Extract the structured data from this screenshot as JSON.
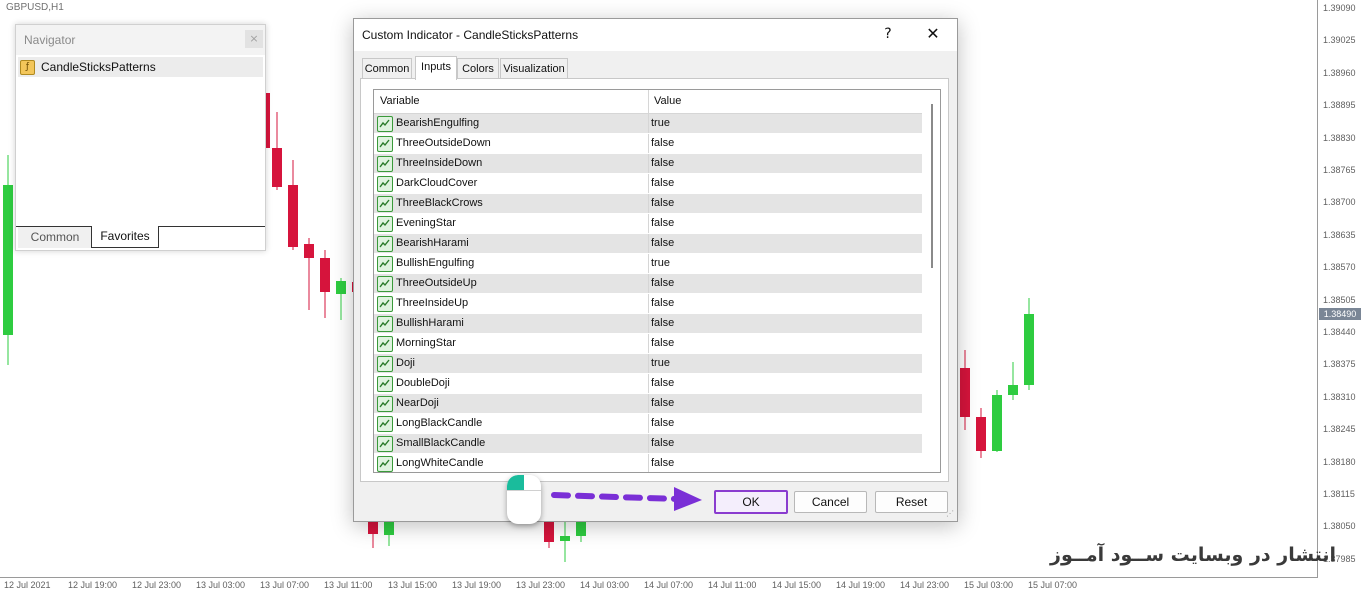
{
  "chart": {
    "symbol": "GBPUSD,H1",
    "current_price": "1.38490",
    "price_levels": [
      "1.39090",
      "1.39025",
      "1.38960",
      "1.38895",
      "1.38830",
      "1.38765",
      "1.38700",
      "1.38635",
      "1.38570",
      "1.38505",
      "1.38440",
      "1.38375",
      "1.38310",
      "1.38245",
      "1.38180",
      "1.38115",
      "1.38050",
      "1.37985"
    ],
    "time_labels": [
      "12 Jul 2021",
      "12 Jul 19:00",
      "12 Jul 23:00",
      "13 Jul 03:00",
      "13 Jul 07:00",
      "13 Jul 11:00",
      "13 Jul 15:00",
      "13 Jul 19:00",
      "13 Jul 23:00",
      "14 Jul 03:00",
      "14 Jul 07:00",
      "14 Jul 11:00",
      "14 Jul 15:00",
      "14 Jul 19:00",
      "14 Jul 23:00",
      "15 Jul 03:00",
      "15 Jul 07:00"
    ],
    "bull_color": "#2ecc40",
    "bear_color": "#d6143c"
  },
  "navigator": {
    "title": "Navigator",
    "close": "×",
    "item": "CandleSticksPatterns",
    "tabs": [
      "Common",
      "Favorites"
    ]
  },
  "dialog": {
    "title": "Custom Indicator - CandleSticksPatterns",
    "help": "?",
    "close": "✕",
    "tabs": [
      "Common",
      "Inputs",
      "Colors",
      "Visualization"
    ],
    "active_tab": "Inputs",
    "columns": {
      "variable": "Variable",
      "value": "Value"
    },
    "inputs": [
      {
        "variable": "BearishEngulfing",
        "value": "true"
      },
      {
        "variable": "ThreeOutsideDown",
        "value": "false"
      },
      {
        "variable": "ThreeInsideDown",
        "value": "false"
      },
      {
        "variable": "DarkCloudCover",
        "value": "false"
      },
      {
        "variable": "ThreeBlackCrows",
        "value": "false"
      },
      {
        "variable": "EveningStar",
        "value": "false"
      },
      {
        "variable": "BearishHarami",
        "value": "false"
      },
      {
        "variable": "BullishEngulfing",
        "value": "true"
      },
      {
        "variable": "ThreeOutsideUp",
        "value": "false"
      },
      {
        "variable": "ThreeInsideUp",
        "value": "false"
      },
      {
        "variable": "BullishHarami",
        "value": "false"
      },
      {
        "variable": "MorningStar",
        "value": "false"
      },
      {
        "variable": "Doji",
        "value": "true"
      },
      {
        "variable": "DoubleDoji",
        "value": "false"
      },
      {
        "variable": "NearDoji",
        "value": "false"
      },
      {
        "variable": "LongBlackCandle",
        "value": "false"
      },
      {
        "variable": "SmallBlackCandle",
        "value": "false"
      },
      {
        "variable": "LongWhiteCandle",
        "value": "false"
      }
    ],
    "buttons": {
      "ok": "OK",
      "cancel": "Cancel",
      "reset": "Reset"
    }
  },
  "annotation": {
    "arrow_color": "#7a2fd6"
  },
  "watermark": "انتشار در وبسایت ســود آمــوز"
}
